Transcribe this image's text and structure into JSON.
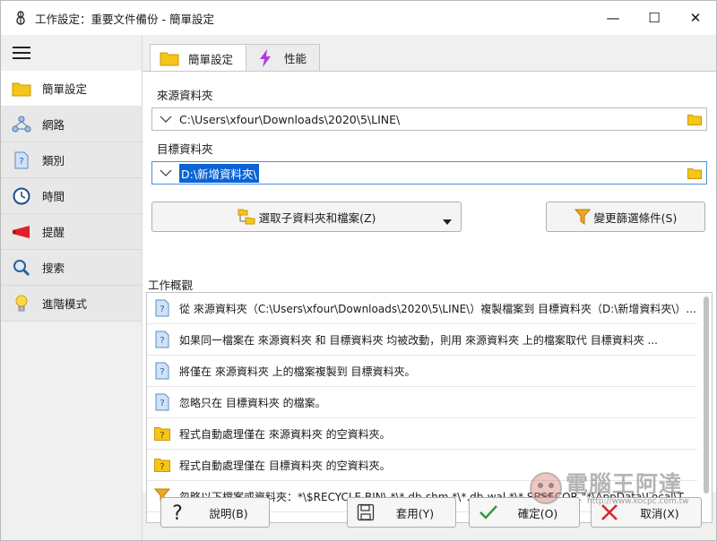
{
  "window": {
    "title": "工作設定：重要文件備份 - 簡單設定",
    "controls": {
      "minimize": "—",
      "maximize": "☐",
      "close": "✕"
    }
  },
  "sidebar": {
    "items": [
      {
        "label": "簡單設定",
        "icon": "folder-icon",
        "active": true
      },
      {
        "label": "網路",
        "icon": "network-icon",
        "active": false
      },
      {
        "label": "類別",
        "icon": "document-question-icon",
        "active": false
      },
      {
        "label": "時間",
        "icon": "clock-icon",
        "active": false
      },
      {
        "label": "提醒",
        "icon": "megaphone-icon",
        "active": false
      },
      {
        "label": "搜索",
        "icon": "magnifier-icon",
        "active": false
      },
      {
        "label": "進階模式",
        "icon": "lightbulb-icon",
        "active": false
      }
    ]
  },
  "tabs": [
    {
      "label": "簡單設定",
      "icon": "folder-icon",
      "active": true
    },
    {
      "label": "性能",
      "icon": "lightning-icon",
      "active": false
    }
  ],
  "source": {
    "label": "來源資料夾",
    "value": "C:\\Users\\xfour\\Downloads\\2020\\5\\LINE\\"
  },
  "target": {
    "label": "目標資料夾",
    "value": "D:\\新增資料夾\\"
  },
  "buttons": {
    "select_subfolders": "選取子資料夾和檔案(Z)",
    "change_filter": "變更篩選條件(S)"
  },
  "summary": {
    "label": "工作概觀",
    "rows": [
      {
        "icon": "doc-question-icon",
        "text": "從 來源資料夾（C:\\Users\\xfour\\Downloads\\2020\\5\\LINE\\）複製檔案到 目標資料夾（D:\\新增資料夾\\）..."
      },
      {
        "icon": "doc-question-icon",
        "text": "如果同一檔案在 來源資料夾 和 目標資料夾 均被改動，則用 來源資料夾 上的檔案取代 目標資料夾 ..."
      },
      {
        "icon": "doc-question-icon",
        "text": "將僅在 來源資料夾 上的檔案複製到 目標資料夾。"
      },
      {
        "icon": "doc-question-icon",
        "text": "忽略只在 目標資料夾 的檔案。"
      },
      {
        "icon": "folder-question-icon",
        "text": "程式自動處理僅在 來源資料夾 的空資料夾。"
      },
      {
        "icon": "folder-question-icon",
        "text": "程式自動處理僅在 目標資料夾 的空資料夾。"
      },
      {
        "icon": "filter-icon",
        "text": "忽略以下檔案或資料夾：*\\$RECYCLE.BIN\\,*\\*.db-shm,*\\*.db-wal,*\\*.SBSECOR,\"*\\AppData\\Local\\Tempor..."
      }
    ]
  },
  "footer": {
    "help": "說明(B)",
    "apply": "套用(Y)",
    "ok": "確定(O)",
    "cancel": "取消(X)"
  },
  "watermark": {
    "text": "電腦王阿達",
    "url": "http://www.kocpc.com.tw"
  },
  "colors": {
    "folder": "#f5c518",
    "selection": "#0a64d6",
    "focus_border": "#4a8fdc",
    "lightning": "#b03ce0",
    "megaphone": "#e0202a",
    "ok_check": "#2e9a3a",
    "cancel_x": "#d8262c"
  }
}
